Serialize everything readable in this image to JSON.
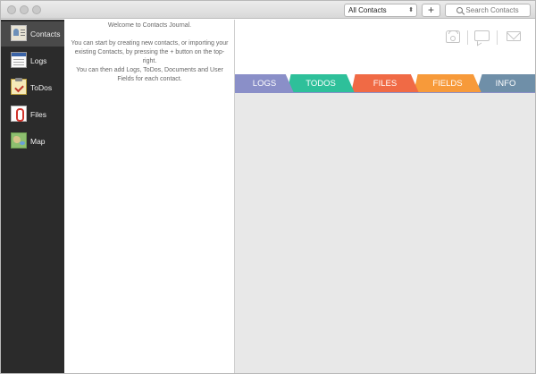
{
  "toolbar": {
    "contact_filter": "All Contacts",
    "add_label": "+",
    "search_placeholder": "Search Contacts"
  },
  "sidebar": {
    "items": [
      {
        "label": "Contacts",
        "icon": "contacts-icon",
        "active": true
      },
      {
        "label": "Logs",
        "icon": "logs-icon",
        "active": false
      },
      {
        "label": "ToDos",
        "icon": "todos-icon",
        "active": false
      },
      {
        "label": "Files",
        "icon": "files-icon",
        "active": false
      },
      {
        "label": "Map",
        "icon": "map-icon",
        "active": false
      }
    ]
  },
  "list": {
    "welcome_title": "Welcome to Contacts Journal.",
    "welcome_body_1": "You can start by creating new contacts, or importing your existing Contacts, by pressing the + button on the top-right.",
    "welcome_body_2": "You can then add Logs, ToDos, Documents and User Fields for each contact."
  },
  "detail": {
    "action_icons": [
      "phone-icon",
      "chat-icon",
      "mail-icon"
    ],
    "tabs": [
      {
        "label": "LOGS",
        "color": "#8a8fc8"
      },
      {
        "label": "TODOS",
        "color": "#2ec09a"
      },
      {
        "label": "FILES",
        "color": "#f06a45"
      },
      {
        "label": "FIELDS",
        "color": "#f79a3a"
      },
      {
        "label": "INFO",
        "color": "#6f8fa8"
      }
    ]
  }
}
